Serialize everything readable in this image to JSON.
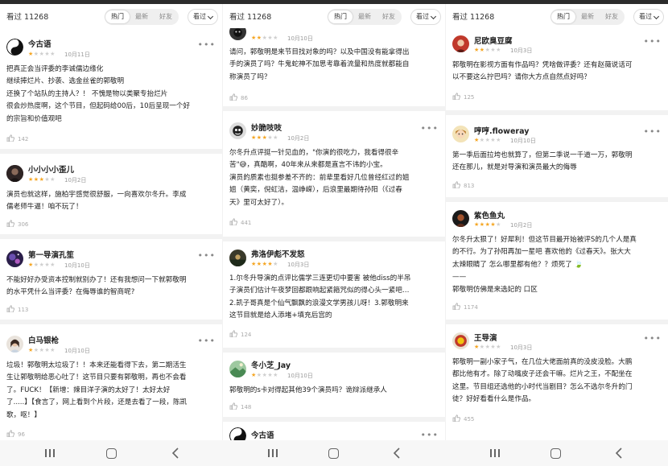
{
  "header": {
    "count": "看过 11268",
    "tabs": [
      "热门",
      "最新",
      "好友"
    ],
    "active_tab": "热门",
    "filter": "看过"
  },
  "colors": {
    "star_on": "#f5a623",
    "star_off": "#cfcfcf"
  },
  "panes": [
    {
      "reviews": [
        {
          "user": "今古语",
          "rating": 1,
          "date": "10月11日",
          "avatar": "yin-yang-icon",
          "lines": [
            "把真正会当评委的李诚儒边缘化",
            "继续捧烂片、抄袭、选金丝雀的郭敬明",
            "还换了个站队的主持人？！ 不愧是物以类聚专抬烂片",
            "很会炒热度啊，这个节目，但起码给00后，10后呈现一个好",
            "的宗旨和价值观吧"
          ],
          "likes": "142"
        },
        {
          "user": "小小小小歪儿",
          "rating": 3,
          "date": "10月2日",
          "avatar": "dark-portrait-avatar",
          "lines": [
            "演员也就这样，施柏宇感觉很舒服，一向喜欢尔冬升。李成",
            "儒老师牛逼！咱不玩了！"
          ],
          "likes": "306"
        },
        {
          "user": "第一导演孔笙",
          "rating": 1,
          "date": "10月10日",
          "avatar": "purple-galaxy-avatar",
          "lines": [
            "不能好好办受资本控制就别办了！还有我想问一下就郭敬明",
            "的水平凭什么当评委？在侮辱谁的智商呢?"
          ],
          "likes": "113"
        },
        {
          "user": "白马银枪",
          "rating": 1,
          "date": "10月10日",
          "avatar": "girl-portrait-avatar",
          "lines": [
            "垃圾！郭敬明太垃圾了！！本来还能看得下去，第二期活生",
            "生让郭敬明给恶心吐了！这节目只要有郭敬明，再也不会看",
            "了。FUCK！【新增：辣目洋子演的太好了！太好太好",
            "了.....】【食言了，网上看到个片段，还是去看了一段，陈凯",
            "歌，呕！】"
          ],
          "likes": "96"
        }
      ]
    },
    {
      "reviews": [
        {
          "user": "",
          "rating": 2,
          "date": "10月10日",
          "avatar": "dark-cat-avatar",
          "lines": [
            "请问，郭敬明是来节目找对象的吗？以及中国没有能拿得出",
            "手的演员了吗？牛鬼蛇神不加思考靠着流量和热度就都能自",
            "称演员了吗？"
          ],
          "likes": "86"
        },
        {
          "user": "妙脆吱吱",
          "rating": 3,
          "date": "10月2日",
          "avatar": "cartoon-face-avatar",
          "lines": [
            "尔冬升点评挺一针见血的，\"你演的很吃力，我看得很辛",
            "苦\"😅，真酷啊，40年来从来都是直言不讳的小宝。",
            "演员的质素也挺参差不齐的：前辈里看好几位曾经红过的姐",
            "姐（黄奕，倪虹洁，温峥嵘），后浪里最期待孙阳（《过春",
            "天》里可太好了）。"
          ],
          "likes": "441"
        },
        {
          "user": "弗洛伊彪不发怒",
          "rating": 4,
          "date": "10月3日",
          "avatar": "sunset-avatar",
          "lines": [
            "1.尔冬升导演的点评比儒学三连更切中要害 被他diss的半吊",
            "子演员们估计午夜梦回都跟响起紧箍咒似的得心头一紧吧…",
            "2.凯子哥真是个仙气飘飘的浪漫文学男孩儿呀！3.郭敬明来",
            "这节目就是给人添堵+填充后宫的"
          ],
          "likes": "124"
        },
        {
          "user": "冬小芝_Jay",
          "rating": 1,
          "date": "10月10日",
          "avatar": "green-landscape-avatar",
          "lines": [
            "郭敬明的s卡对得起其他39个演员吗？诡辩派继承人"
          ],
          "likes": "148"
        },
        {
          "user": "今古语",
          "rating": 0,
          "date": "",
          "avatar": "yin-yang-icon",
          "lines": [],
          "likes": ""
        }
      ]
    },
    {
      "reviews": [
        {
          "user": "尼欧臭豆腐",
          "rating": 2,
          "date": "10月3日",
          "avatar": "red-portrait-avatar",
          "lines": [
            "郭敬明在影视方面有作品吗？凭啥做评委？还有赵薇说话可",
            "以不要这么拧巴吗？请你大方点自然点好吗？"
          ],
          "likes": "125"
        },
        {
          "user": "哼哼.floweray",
          "rating": 1,
          "date": "10月10日",
          "avatar": "cartoon-girl-avatar",
          "lines": [
            "第一季后面拉垮也就算了，但第二季说一千道一万，郭敬明",
            "还在那儿，就是对导演和演员最大的侮辱"
          ],
          "likes": "813"
        },
        {
          "user": "紫色鱼丸",
          "rating": 4,
          "date": "10月2日",
          "avatar": "dark-portrait-avatar",
          "lines": [
            "尔冬升太狠了！好犀利！但这节目最开始被评S的几个人是真",
            "的不行。为了孙阳再加一星吧 喜欢他的《过春天》。张大大",
            "太辣眼睛了 怎么哪里都有他？？烦死了 🍃",
            "——",
            "郭敬明仿佛是来选妃的 口区"
          ],
          "likes": "1174"
        },
        {
          "user": "王导演",
          "rating": 1,
          "date": "10月3日",
          "avatar": "red-badge-avatar",
          "lines": [
            "郭敬明一副小家子气，在几位大佬面前真的没皮没脸。大鹏",
            "都比他有才。除了动嘴皮子还会干嘛。烂片之王，不配坐在",
            "这里。节目组还选他的小时代当剧目？怎么不选尔冬升的门",
            "徒？好好看看什么是作品。"
          ],
          "likes": "455"
        }
      ]
    }
  ],
  "nav": {
    "recent": "recent-apps",
    "home": "home",
    "back": "back"
  }
}
